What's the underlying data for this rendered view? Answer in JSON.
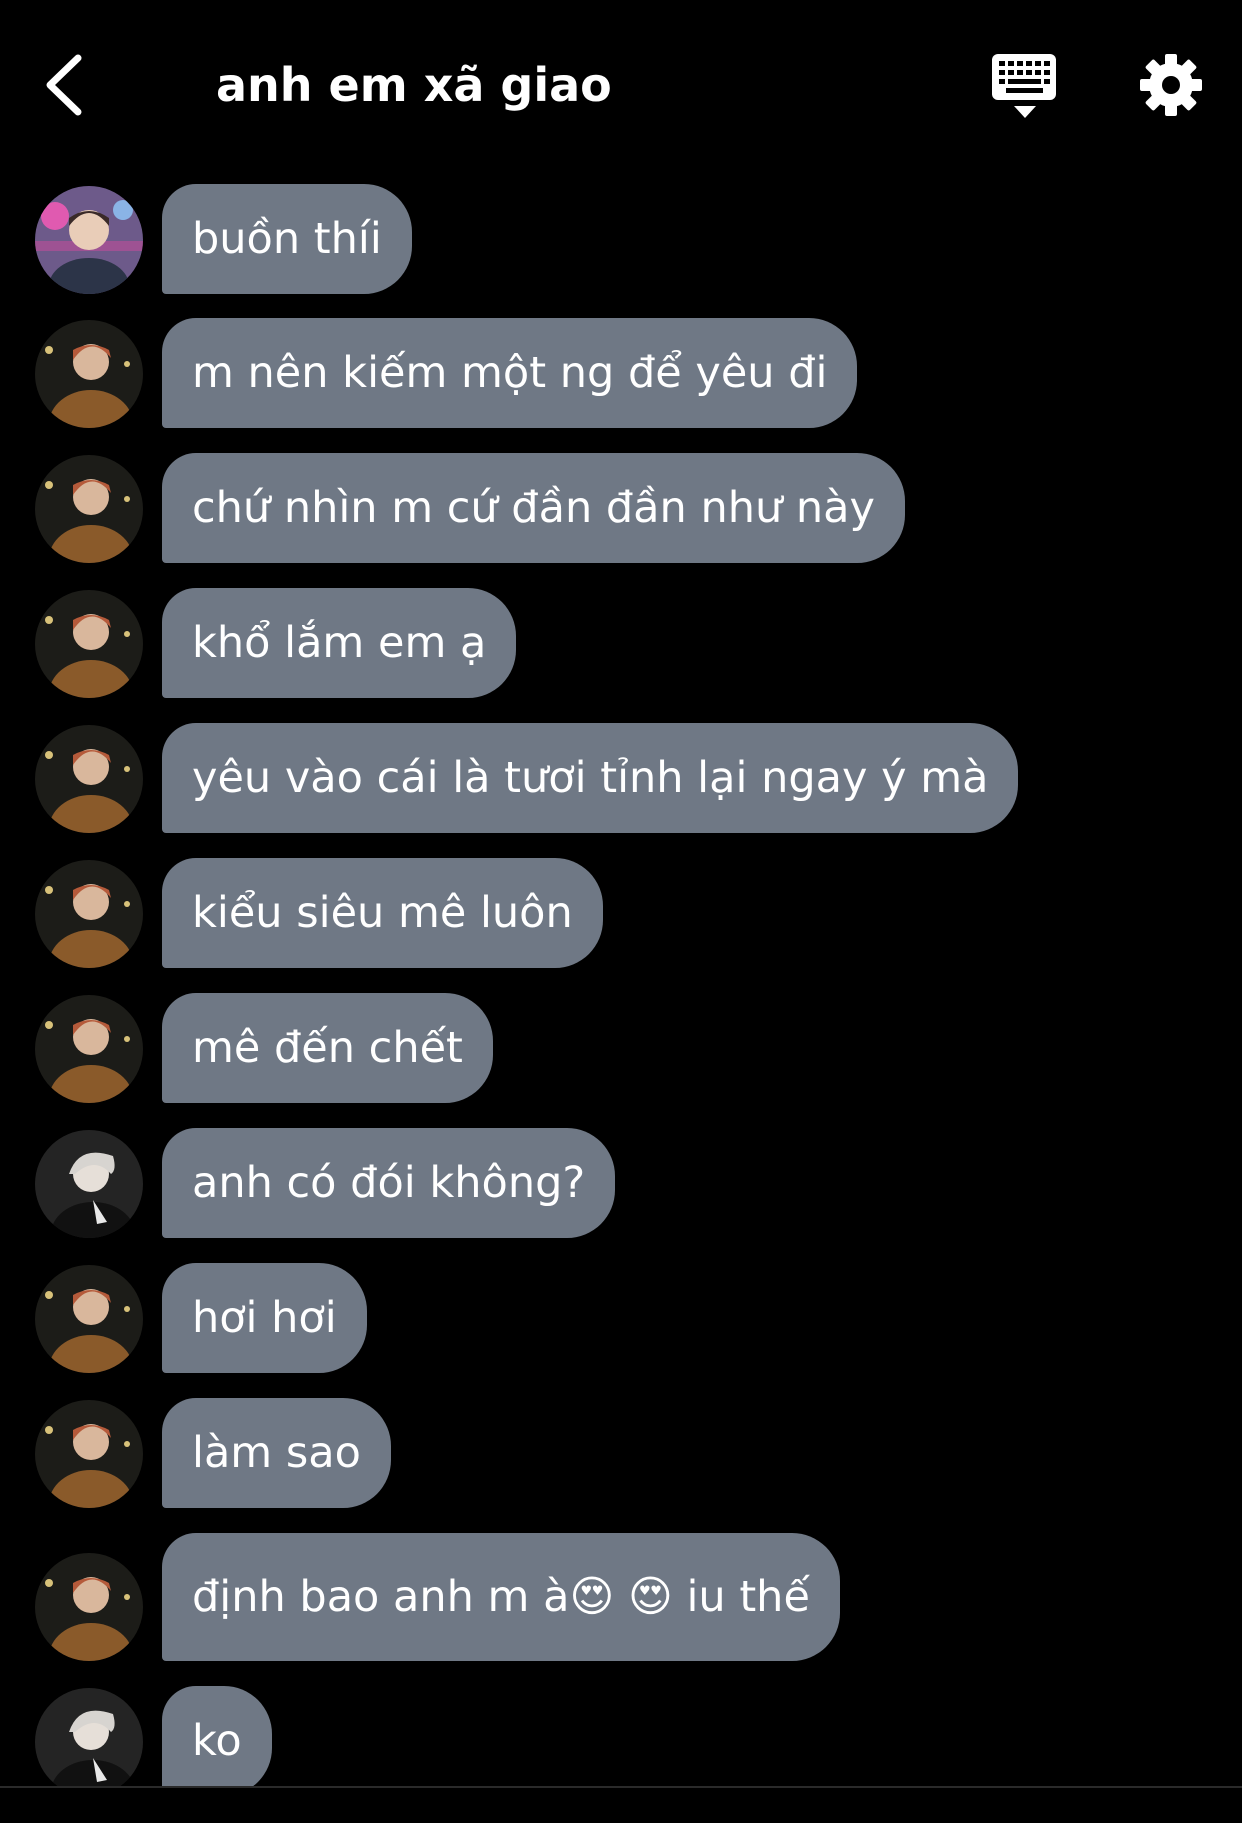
{
  "header": {
    "title": "anh em xã giao"
  },
  "messages": [
    {
      "text": "buồn thíi",
      "avatar": "pink"
    },
    {
      "text": "m nên kiếm một ng để yêu đi",
      "avatar": "brown"
    },
    {
      "text": "chứ nhìn m cứ đần đần như này",
      "avatar": "brown"
    },
    {
      "text": "khổ lắm em ạ",
      "avatar": "brown"
    },
    {
      "text": "yêu vào cái là tươi tỉnh lại ngay ý mà",
      "avatar": "brown"
    },
    {
      "text": "kiểu siêu mê luôn",
      "avatar": "brown"
    },
    {
      "text": "mê đến chết",
      "avatar": "brown"
    },
    {
      "text": "anh có đói không?",
      "avatar": "gray"
    },
    {
      "text": "hơi hơi",
      "avatar": "brown"
    },
    {
      "text": "làm sao",
      "avatar": "brown"
    },
    {
      "text": "định bao anh m à😍 😍 iu thế",
      "avatar": "brown"
    },
    {
      "text": "ko",
      "avatar": "gray"
    }
  ],
  "colors": {
    "background": "#000000",
    "bubble": "#6f7885",
    "text": "#ffffff"
  },
  "icons": {
    "back": "chevron-left-icon",
    "keyboard": "keyboard-icon",
    "settings": "gear-icon"
  }
}
